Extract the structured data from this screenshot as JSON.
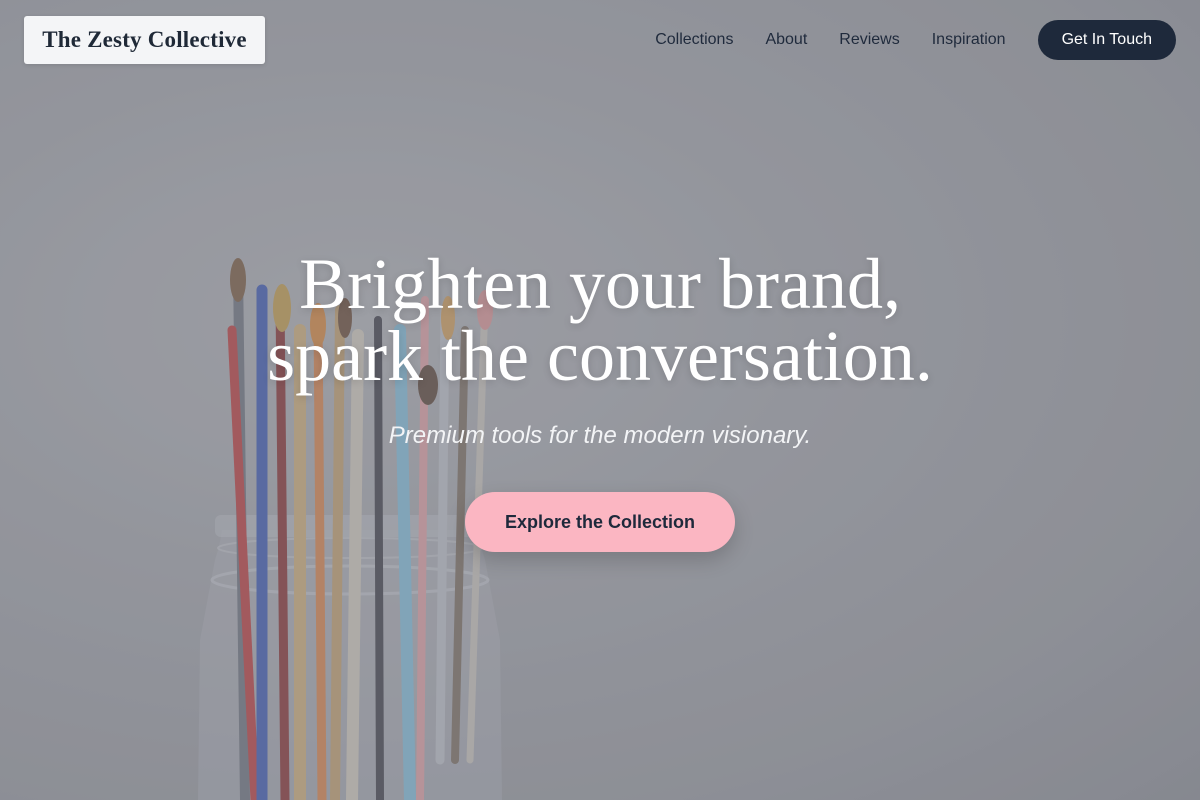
{
  "brand": {
    "name": "The Zesty Collective"
  },
  "nav": {
    "links": [
      {
        "label": "Collections"
      },
      {
        "label": "About"
      },
      {
        "label": "Reviews"
      },
      {
        "label": "Inspiration"
      }
    ],
    "cta_label": "Get In Touch"
  },
  "hero": {
    "title_line1": "Brighten your brand,",
    "title_line2": "spark the conversation.",
    "subtitle": "Premium tools for the modern visionary.",
    "button_label": "Explore the Collection",
    "background": "photo-brushes-in-jar"
  },
  "colors": {
    "nav_cta_bg": "#1e293b",
    "hero_button_bg": "#fbb6c2",
    "text_dark": "#1f2937",
    "text_light": "#ffffff"
  }
}
